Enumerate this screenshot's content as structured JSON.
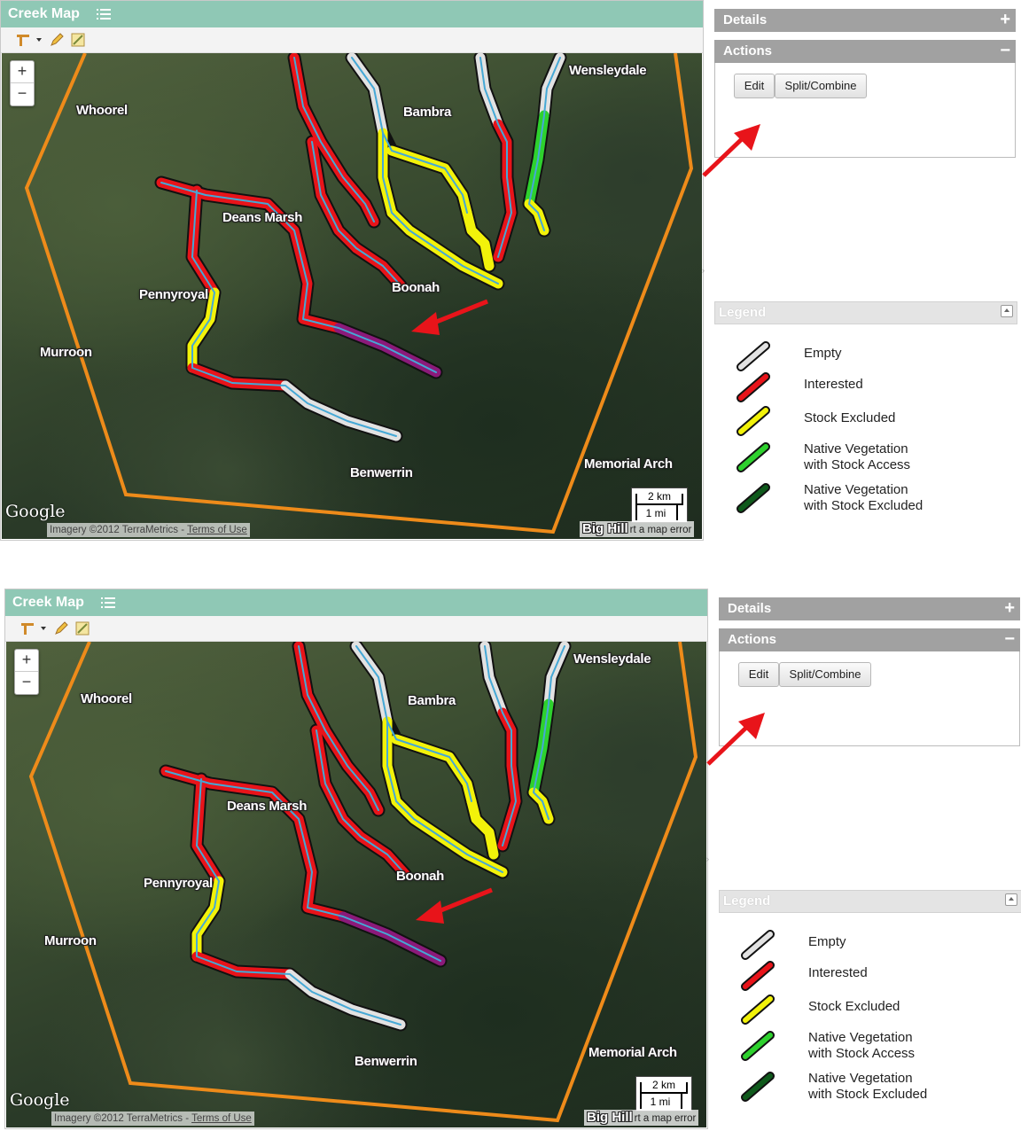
{
  "map_panel": {
    "title": "Creek Map",
    "zoom_in": "+",
    "zoom_out": "−",
    "places": {
      "whoorel": "Whoorel",
      "bambra": "Bambra",
      "wensleydale": "Wensleydale",
      "deans_marsh": "Deans Marsh",
      "pennyroyal": "Pennyroyal",
      "murroon": "Murroon",
      "boonah": "Boonah",
      "benwerrin": "Benwerrin",
      "memorial_arch": "Memorial Arch",
      "big_hill": "Big Hill"
    },
    "scale": {
      "km": "2 km",
      "mi": "1 mi"
    },
    "google": "Google",
    "imagery": "Imagery ©2012 TerraMetrics - ",
    "terms": "Terms of Use",
    "report_error": "rt a map error"
  },
  "sidebar": {
    "details": {
      "label": "Details",
      "control": "+"
    },
    "actions": {
      "label": "Actions",
      "control": "−",
      "edit": "Edit",
      "split_combine": "Split/Combine"
    },
    "legend": {
      "label": "Legend",
      "items": [
        {
          "line1": "Empty",
          "line2": "",
          "color": "#e2e2e2"
        },
        {
          "line1": "Interested",
          "line2": "",
          "color": "#e8141a"
        },
        {
          "line1": "Stock Excluded",
          "line2": "",
          "color": "#f2f20a"
        },
        {
          "line1": "Native Vegetation",
          "line2": "with Stock Access",
          "color": "#2ed12e"
        },
        {
          "line1": "Native Vegetation",
          "line2": "with Stock Excluded",
          "color": "#0f5a1c"
        }
      ]
    }
  },
  "colors": {
    "title_bar": "#8fc8b5",
    "boundary": "#ee8b1a",
    "creek_water": "#45a8d6",
    "selected_segment": "#8b1a7a",
    "annotation_arrow": "#e8141a"
  }
}
